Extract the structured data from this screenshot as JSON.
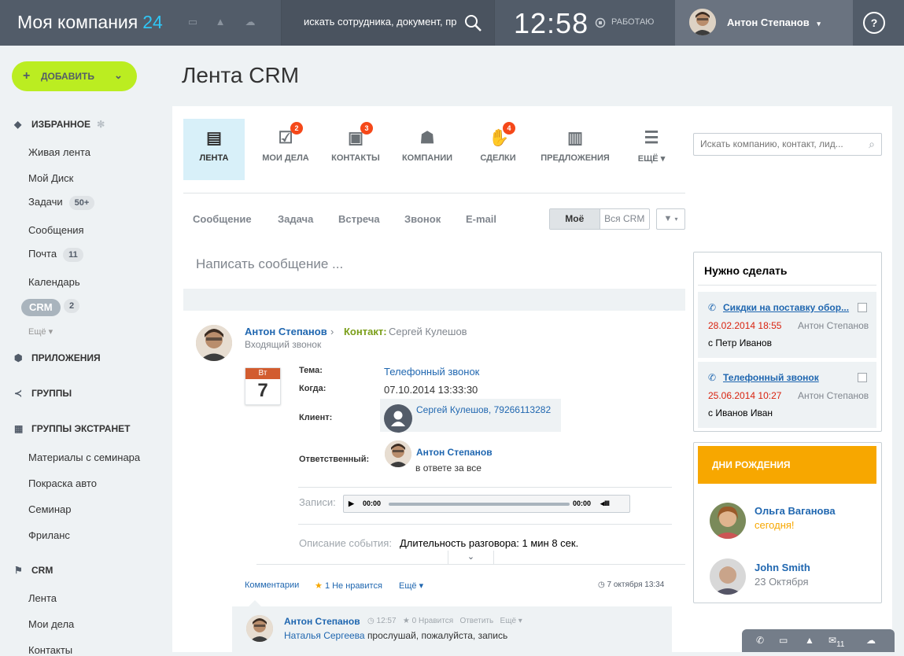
{
  "header": {
    "logo_text": "Моя компания",
    "logo_number": "24",
    "search_placeholder": "искать сотрудника, документ, пр",
    "clock": "12:58",
    "work_status": "РАБОТАЮ",
    "user_name": "Антон Степанов",
    "help": "?"
  },
  "sidebar": {
    "add_button": "ДОБАВИТЬ",
    "favorites": "ИЗБРАННОЕ",
    "items": [
      {
        "label": "Живая лента"
      },
      {
        "label": "Мой Диск"
      },
      {
        "label": "Задачи",
        "badge": "50+"
      },
      {
        "label": "Сообщения"
      },
      {
        "label": "Почта",
        "badge": "11"
      },
      {
        "label": "Календарь"
      },
      {
        "label": "CRM",
        "badge": "2"
      }
    ],
    "more": "Ещё",
    "apps": "ПРИЛОЖЕНИЯ",
    "groups": "ГРУППЫ",
    "extranet": "ГРУППЫ ЭКСТРАНЕТ",
    "extranet_items": [
      "Материалы с семинара",
      "Покраска авто",
      "Семинар",
      "Фриланс"
    ],
    "crm_section": "CRM",
    "crm_items": [
      "Лента",
      "Мои дела",
      "Контакты"
    ]
  },
  "page_title": "Лента CRM",
  "crm_tabs": [
    {
      "label": "ЛЕНТА",
      "icon": "document-icon"
    },
    {
      "label": "МОИ ДЕЛА",
      "icon": "checklist-icon",
      "count": "2"
    },
    {
      "label": "КОНТАКТЫ",
      "icon": "contact-card-icon",
      "count": "3"
    },
    {
      "label": "КОМПАНИИ",
      "icon": "people-icon"
    },
    {
      "label": "СДЕЛКИ",
      "icon": "handshake-icon",
      "count": "4"
    },
    {
      "label": "ПРЕДЛОЖЕНИЯ",
      "icon": "proposal-icon"
    },
    {
      "label": "ЕЩЁ",
      "icon": "list-icon"
    }
  ],
  "crm_search_placeholder": "Искать компанию, контакт, лид...",
  "activity_tabs": [
    "Сообщение",
    "Задача",
    "Встреча",
    "Звонок",
    "E-mail"
  ],
  "scope": {
    "mine": "Моё",
    "all": "Вся CRM"
  },
  "compose_placeholder": "Написать сообщение ...",
  "event": {
    "author": "Антон Степанов",
    "contact_label": "Контакт:",
    "contact_name": "Сергей Кулешов",
    "type": "Входящий звонок",
    "cal_weekday": "Вт",
    "cal_day": "7",
    "subject_label": "Тема:",
    "subject": "Телефонный звонок",
    "when_label": "Когда:",
    "when": "07.10.2014 13:33:30",
    "client_label": "Клиент:",
    "client": "Сергей Кулешов,",
    "client_phone": "79266113282",
    "responsible_label": "Ответственный:",
    "responsible_name": "Антон Степанов",
    "responsible_note": "в ответе за все",
    "records_label": "Записи:",
    "player_time_start": "00:00",
    "player_time_end": "00:00",
    "description_label": "Описание события:",
    "description": "Длительность разговора: 1 мин 8 сек.",
    "comments_link": "Комментарии",
    "like_text": "1 Не нравится",
    "more_link": "Ещё",
    "timestamp": "7 октября 13:34"
  },
  "comment": {
    "author": "Антон Степанов",
    "time": "12:57",
    "likes": "0 Нравится",
    "reply": "Ответить",
    "more": "Ещё",
    "mention": "Наталья Сергеева",
    "text": "прослушай, пожалуйста, запись"
  },
  "todo": {
    "title": "Нужно сделать",
    "items": [
      {
        "title": "Сикдки на поставку обор...",
        "date": "28.02.2014 18:55",
        "owner": "Антон Степанов",
        "with": "с Петр Иванов"
      },
      {
        "title": "Телефонный звонок",
        "date": "25.06.2014 10:27",
        "owner": "Антон Степанов",
        "with": "с Иванов Иван"
      }
    ]
  },
  "birthdays": {
    "title": "ДНИ РОЖДЕНИЯ",
    "people": [
      {
        "name": "Ольга Ваганова",
        "date": "сегодня!"
      },
      {
        "name": "John Smith",
        "date": "23 Октября"
      }
    ]
  },
  "bottom_bar": {
    "mail_count": "11"
  },
  "colors": {
    "topbar": "#525c69",
    "accent_green": "#bbed21",
    "link": "#2067b0",
    "birthday": "#f7a700",
    "counter": "#f54819"
  }
}
